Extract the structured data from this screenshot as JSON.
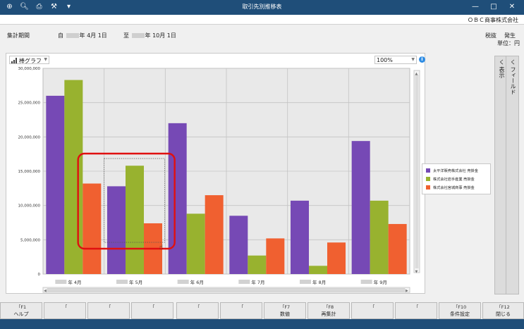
{
  "window": {
    "title": "取引先別推移表"
  },
  "toolbar": {
    "icons": [
      "zoom-in-icon",
      "zoom-search-icon",
      "print-icon",
      "tool-icon",
      "menu-down-icon"
    ]
  },
  "company": {
    "name": "ＯＢＣ商事株式会社"
  },
  "header": {
    "period_label": "集計期間",
    "from_prefix": "自",
    "from_suffix": "年  4月 1日",
    "to_prefix": "至",
    "to_suffix": "年 10月 1日",
    "tax": "税抜",
    "occurrence": "発生",
    "unit": "単位：円"
  },
  "controls": {
    "graph_type": "棒グラフ",
    "zoom": "100%"
  },
  "side_tabs": {
    "display": "く 表示",
    "field": "く フィールド"
  },
  "chart_data": {
    "type": "bar",
    "categories": [
      "年  4月",
      "年  5月",
      "年  6月",
      "年  7月",
      "年  8月",
      "年  9月"
    ],
    "series": [
      {
        "name": "太平洋販売株式会社 売掛金",
        "color": "#7649b5",
        "values": [
          26000000,
          12800000,
          22000000,
          8500000,
          10700000,
          19400000
        ]
      },
      {
        "name": "株式会社岩手産業 売掛金",
        "color": "#98b22f",
        "values": [
          28300000,
          15800000,
          8800000,
          2700000,
          1200000,
          10700000
        ]
      },
      {
        "name": "株式会社宮城商事 売掛金",
        "color": "#f06030",
        "values": [
          13200000,
          7400000,
          11500000,
          5200000,
          4600000,
          7300000
        ]
      }
    ],
    "yticks": [
      "0",
      "5,000,000",
      "10,000,000",
      "15,000,000",
      "20,000,000",
      "25,000,000",
      "30,000,000"
    ],
    "ylim": [
      0,
      30000000
    ],
    "grid": true,
    "legend": "right"
  },
  "fkeys": [
    {
      "key": "F1",
      "label": "ヘルプ"
    },
    {
      "key": "",
      "label": ""
    },
    {
      "key": "",
      "label": ""
    },
    {
      "key": "",
      "label": ""
    },
    {
      "key": "",
      "label": ""
    },
    {
      "key": "",
      "label": ""
    },
    {
      "key": "F7",
      "label": "数値"
    },
    {
      "key": "F8",
      "label": "再集計"
    },
    {
      "key": "",
      "label": ""
    },
    {
      "key": "",
      "label": ""
    },
    {
      "key": "F10",
      "label": "条件設定"
    },
    {
      "key": "",
      "label": ""
    },
    {
      "key": "F12",
      "label": "閉じる"
    }
  ]
}
